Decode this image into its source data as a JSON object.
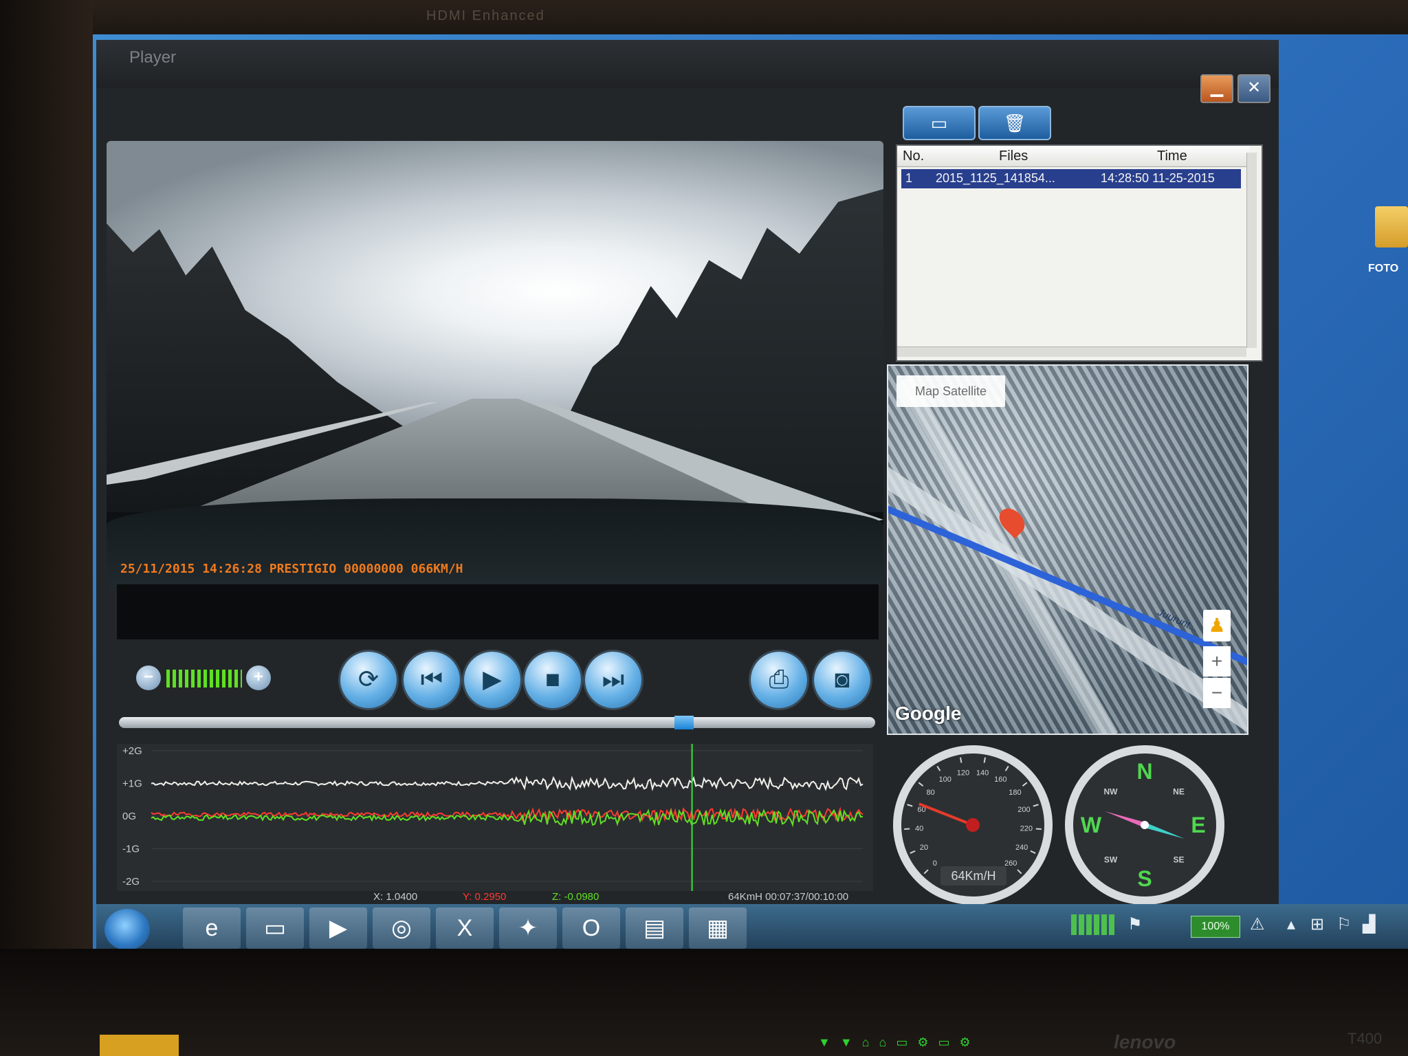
{
  "brand_top": "HDMI Enhanced",
  "brand_bottom": "lenovo",
  "model_label": "T400",
  "desktop": {
    "folder_label": "FOTO"
  },
  "window": {
    "title": "Player",
    "min_icon": "minimize-icon",
    "close_icon": "close-icon"
  },
  "video": {
    "overlay_text": "25/11/2015 14:26:28 PRESTIGIO 00000000 066KM/H"
  },
  "controls": {
    "volume_level": 1.0,
    "buttons": [
      "loop-icon",
      "previous-icon",
      "play-icon",
      "stop-icon",
      "next-icon",
      "print-icon",
      "camera-icon"
    ],
    "seek_progress": 0.747
  },
  "file_toolbar": {
    "open_icon": "folder-icon",
    "delete_icon": "trash-icon"
  },
  "file_list": {
    "columns": [
      "No.",
      "Files",
      "Time"
    ],
    "rows": [
      {
        "no": "1",
        "file": "2015_1125_141854...",
        "time": "14:28:50 11-25-2015"
      }
    ]
  },
  "map": {
    "type_label": "Map  Satellite",
    "street_label": "Juurunt...",
    "zoom_in": "+",
    "zoom_out": "−",
    "logo": "Google"
  },
  "gsensor": {
    "ticks": [
      "+2G",
      "+1G",
      "0G",
      "-1G",
      "-2G"
    ],
    "readout_x": "X: 1.0400",
    "readout_y": "Y: 0.2950",
    "readout_z": "Z: -0.0980",
    "readout_time": "64KmH 00:07:37/00:10:00",
    "cursor_position": 0.76,
    "colors": {
      "x": "#f2f2ec",
      "y": "#ff3b2f",
      "z": "#5fe023"
    }
  },
  "speedometer": {
    "labels": [
      "0",
      "20",
      "40",
      "60",
      "80",
      "100",
      "120",
      "140",
      "160",
      "180",
      "200",
      "220",
      "240",
      "260"
    ],
    "readout": "64Km/H",
    "value": 64
  },
  "compass": {
    "labels": [
      "N",
      "NE",
      "E",
      "SE",
      "S",
      "SW",
      "W",
      "NW"
    ]
  },
  "taskbar": {
    "apps": [
      "internet-explorer-icon",
      "explorer-icon",
      "media-player-icon",
      "chrome-icon",
      "excel-icon",
      "app-icon",
      "outlook-icon",
      "notepad-icon",
      "player-icon"
    ],
    "battery": "100%"
  }
}
